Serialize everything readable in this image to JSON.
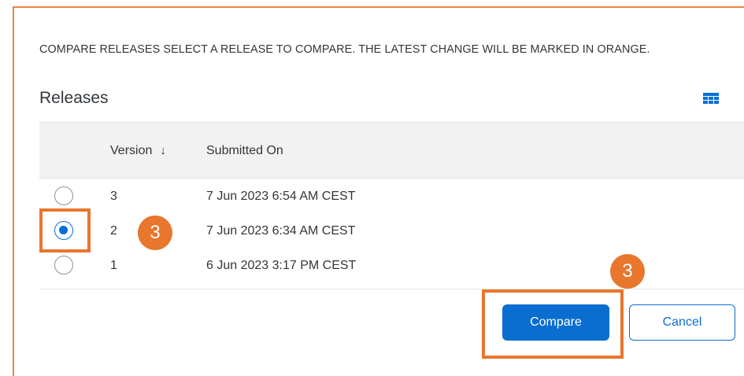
{
  "dialog": {
    "title": "COMPARE RELEASES SELECT A RELEASE TO COMPARE. THE LATEST CHANGE WILL BE MARKED IN ORANGE."
  },
  "releases": {
    "section_title": "Releases",
    "settings_icon": "table-settings-icon",
    "columns": {
      "version": "Version",
      "version_sort": "↓",
      "submitted_on": "Submitted On"
    },
    "rows": [
      {
        "version": "3",
        "submitted_on": "7 Jun 2023 6:54 AM CEST",
        "selected": false
      },
      {
        "version": "2",
        "submitted_on": "7 Jun 2023 6:34 AM CEST",
        "selected": true
      },
      {
        "version": "1",
        "submitted_on": "6 Jun 2023 3:17 PM CEST",
        "selected": false
      }
    ]
  },
  "annotations": {
    "callout_row": "3",
    "callout_button": "3",
    "highlight_color": "#e8762c"
  },
  "footer": {
    "compare_label": "Compare",
    "cancel_label": "Cancel"
  },
  "colors": {
    "accent": "#0a6ed1",
    "frame": "#f0843b",
    "header_bg": "#f2f2f2",
    "text": "#32363a"
  }
}
